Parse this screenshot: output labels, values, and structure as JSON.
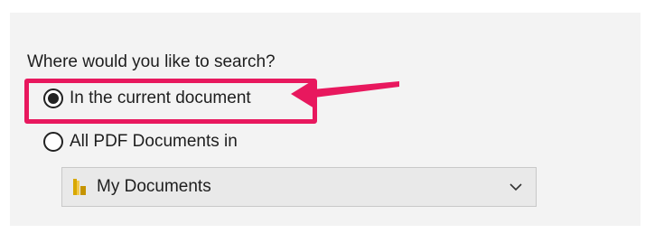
{
  "search": {
    "question": "Where would you like to search?",
    "options": [
      {
        "label": "In the current document",
        "selected": true
      },
      {
        "label": "All PDF Documents in",
        "selected": false
      }
    ],
    "location": {
      "selected": "My Documents",
      "icon": "folder-icon"
    }
  },
  "annotation": {
    "color": "#e8185e",
    "highlight_target": "In the current document"
  }
}
